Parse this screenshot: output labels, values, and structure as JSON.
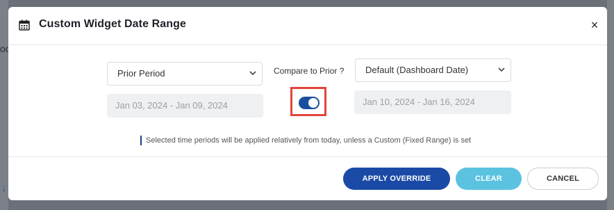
{
  "background": {
    "fragments": [
      "oc",
      "↓"
    ]
  },
  "modal": {
    "title": "Custom Widget Date Range",
    "title_icon": "calendar-icon",
    "close_label": "×"
  },
  "primary": {
    "period_select": "Prior Period",
    "date_range": "Jan 03, 2024 - Jan 09, 2024"
  },
  "compare": {
    "label": "Compare to Prior ?",
    "enabled": true
  },
  "secondary": {
    "period_select": "Default (Dashboard Date)",
    "date_range": "Jan 10, 2024 - Jan 16, 2024"
  },
  "info_text": "Selected time periods will be applied relatively from today, unless a Custom (Fixed Range) is set",
  "buttons": {
    "apply": "APPLY OVERRIDE",
    "clear": "CLEAR",
    "cancel": "CANCEL"
  },
  "colors": {
    "primary": "#1a4aa6",
    "toggle_on": "#1a4fa0",
    "clear": "#5bc2e0",
    "highlight": "#e4443b"
  }
}
